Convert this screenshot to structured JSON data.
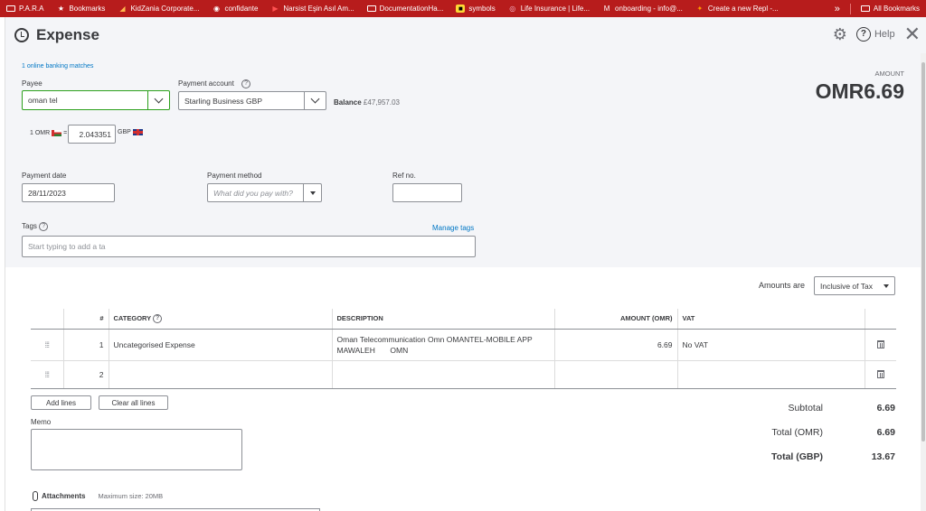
{
  "bookmarks": [
    {
      "label": "P.A.R.A",
      "icon": "folder-icon"
    },
    {
      "label": "Bookmarks",
      "icon": "star-icon"
    },
    {
      "label": "KidZania Corporate...",
      "icon": "bookmark-icon"
    },
    {
      "label": "confidante",
      "icon": "globe-icon"
    },
    {
      "label": "Narsist Eşin Asıl Am...",
      "icon": "youtube-icon"
    },
    {
      "label": "DocumentationHa...",
      "icon": "folder-icon"
    },
    {
      "label": "symbols",
      "icon": "bookmark-icon"
    },
    {
      "label": "Life Insurance | Life...",
      "icon": "bookmark-icon"
    },
    {
      "label": "onboarding - info@...",
      "icon": "gmail-icon"
    },
    {
      "label": "Create a new Repl -...",
      "icon": "replit-icon"
    }
  ],
  "bookmarks_more": "»",
  "all_bookmarks": "All Bookmarks",
  "header": {
    "title": "Expense",
    "help": "Help"
  },
  "form": {
    "banking_matches": "1 online banking matches",
    "payee_label": "Payee",
    "payee_value": "oman tel",
    "payment_account_label": "Payment account",
    "payment_account_value": "Starling Business GBP",
    "balance_label": "Balance",
    "balance_value": "£47,957.03",
    "rate_left": "1 OMR",
    "rate_eq": "=",
    "rate_value": "2.043351",
    "rate_right": "GBP",
    "amount_caption": "AMOUNT",
    "amount_value": "OMR6.69",
    "payment_date_label": "Payment date",
    "payment_date_value": "28/11/2023",
    "payment_method_label": "Payment method",
    "payment_method_placeholder": "What did you pay with?",
    "ref_no_label": "Ref no.",
    "ref_no_value": "",
    "tags_label": "Tags",
    "manage_tags": "Manage tags",
    "tags_placeholder": "Start typing to add a ta"
  },
  "lines": {
    "amounts_are_label": "Amounts are",
    "tax_mode": "Inclusive of Tax",
    "columns": [
      "#",
      "CATEGORY",
      "DESCRIPTION",
      "AMOUNT (OMR)",
      "VAT"
    ],
    "rows": [
      {
        "num": "1",
        "category": "Uncategorised Expense",
        "description": "Oman Telecommunication Omn OMANTEL-MOBILE APP MAWALEH       OMN",
        "amount": "6.69",
        "vat": "No VAT"
      },
      {
        "num": "2",
        "category": "",
        "description": "",
        "amount": "",
        "vat": ""
      }
    ],
    "add_lines": "Add lines",
    "clear_all_lines": "Clear all lines"
  },
  "memo_label": "Memo",
  "totals": [
    {
      "label": "Subtotal",
      "value": "6.69"
    },
    {
      "label": "Total (OMR)",
      "value": "6.69"
    },
    {
      "label": "Total (GBP)",
      "value": "13.67"
    }
  ],
  "attachments": {
    "label": "Attachments",
    "max_size": "Maximum size: 20MB"
  },
  "colors": {
    "bookmark_bar": "#b71c1c",
    "accent_green": "#2ca01c",
    "link_blue": "#0077c5"
  }
}
